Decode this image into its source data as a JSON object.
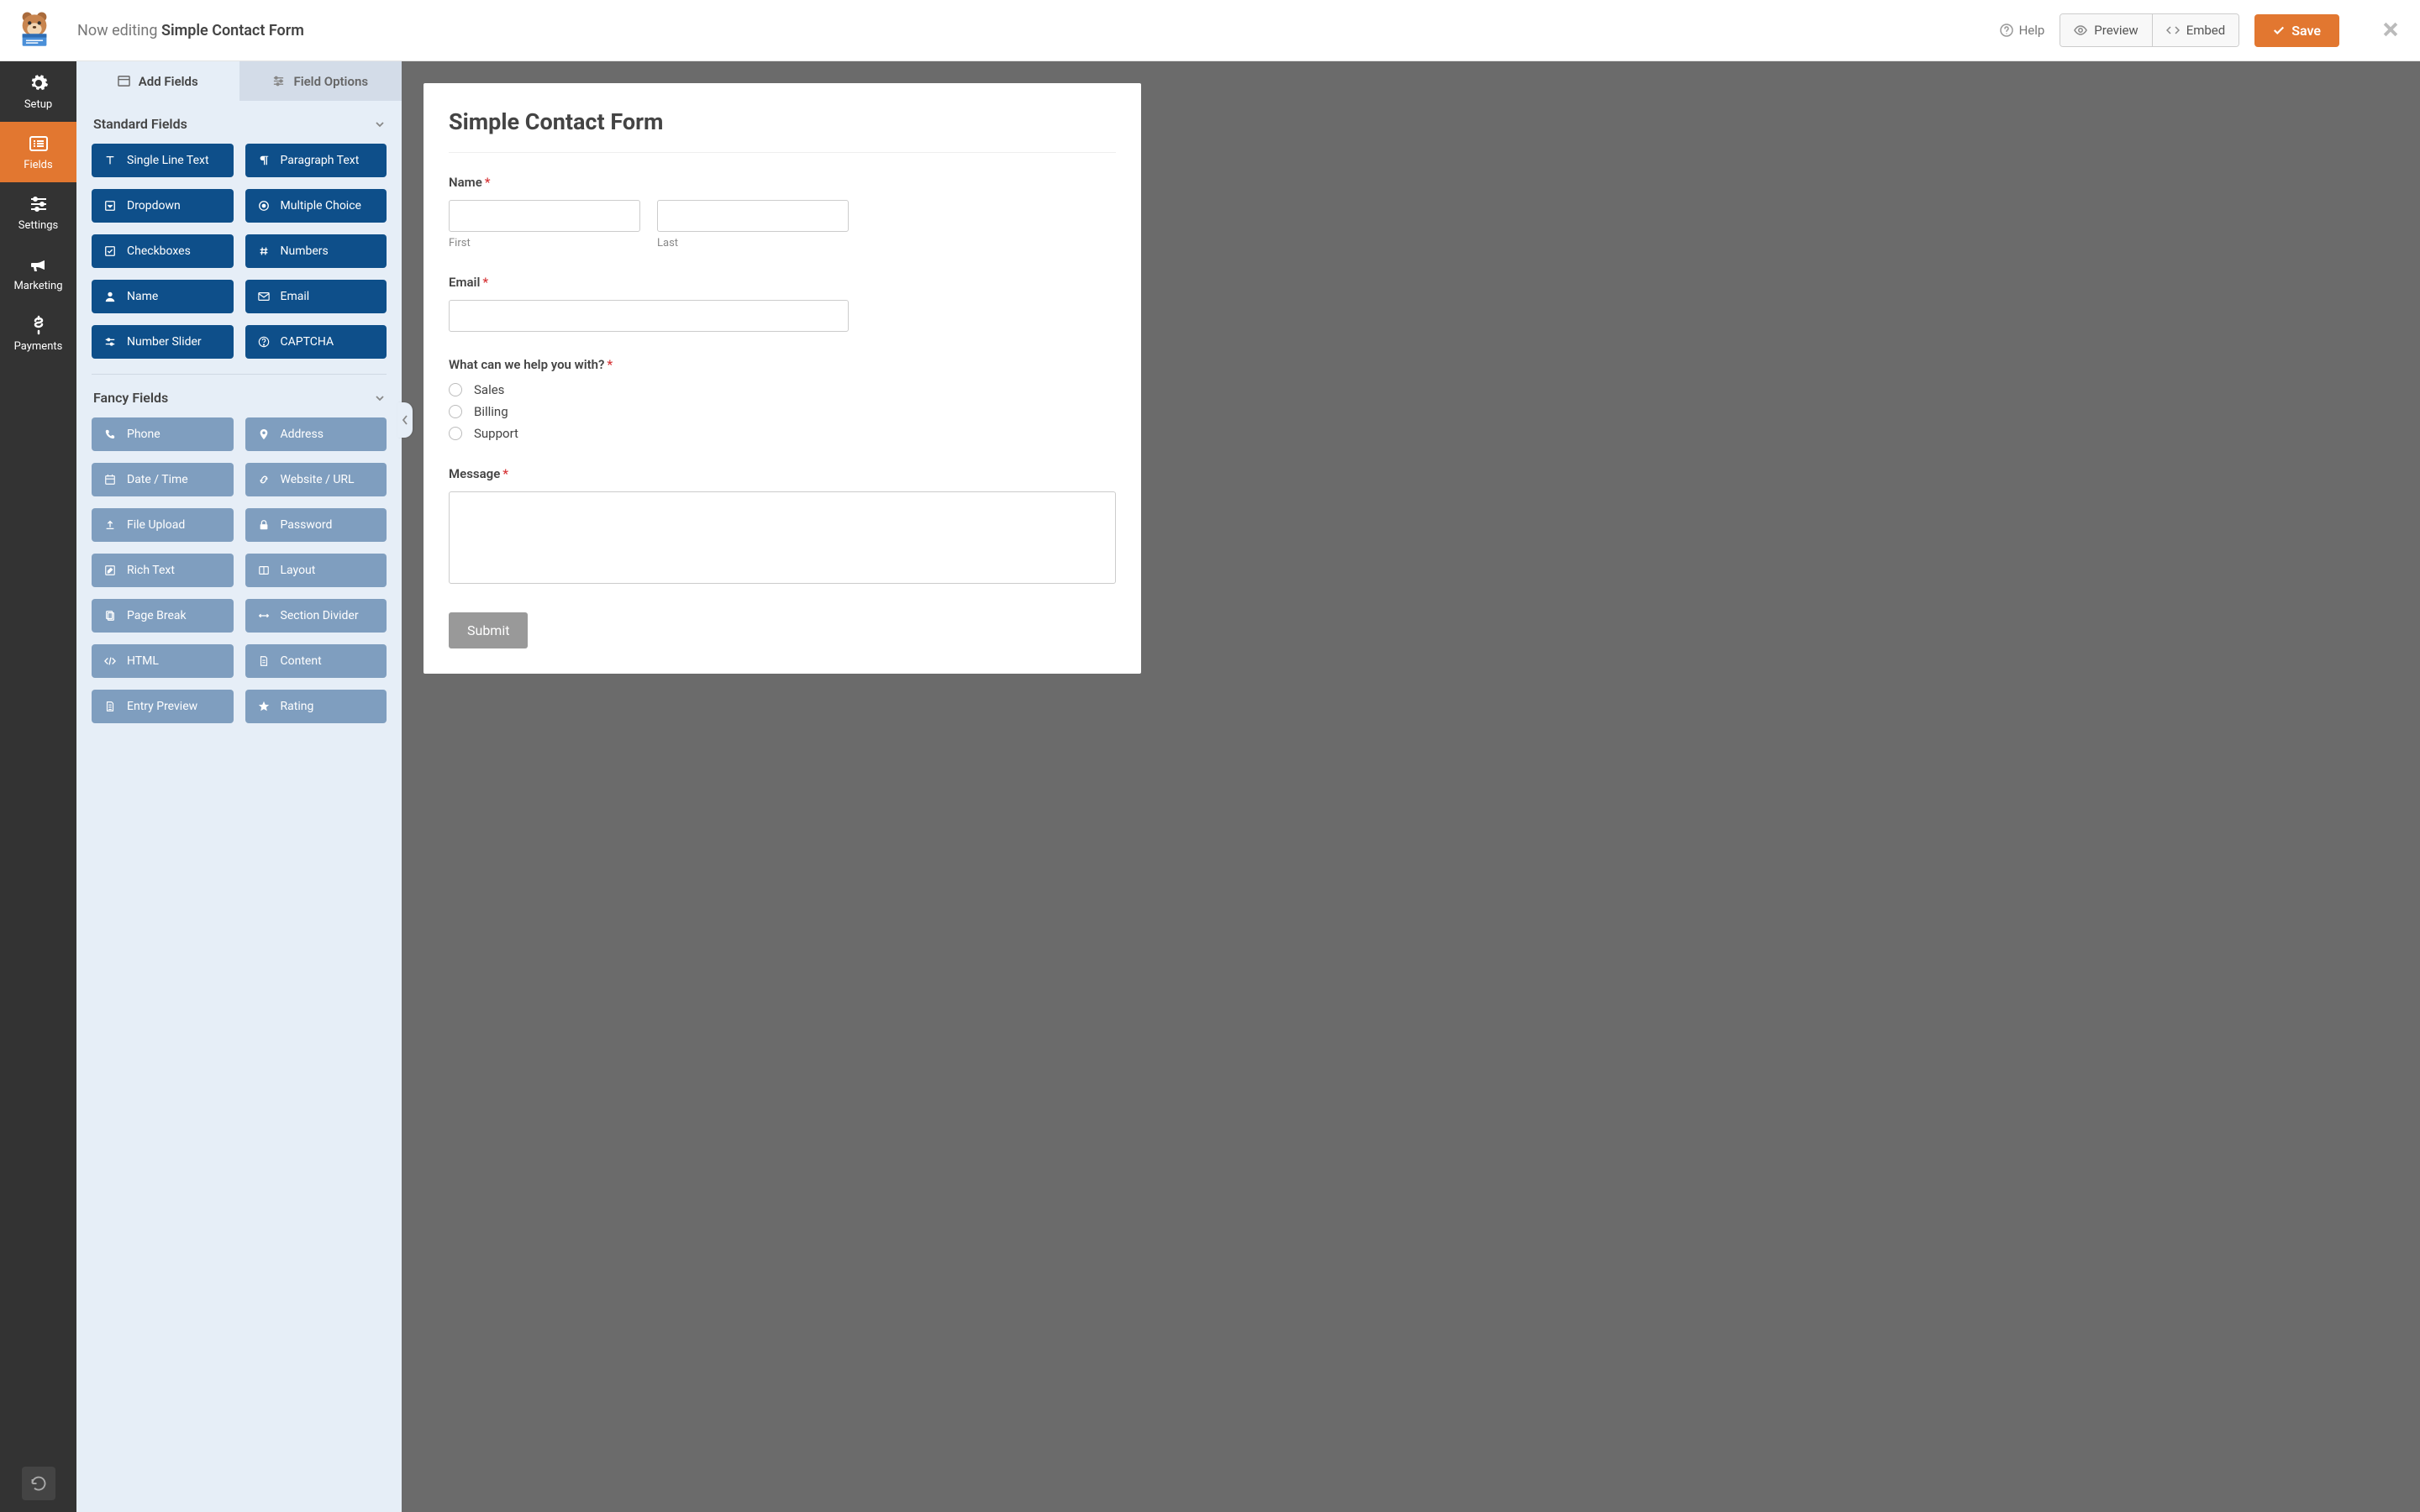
{
  "topbar": {
    "title_prefix": "Now editing",
    "title_name": "Simple Contact Form",
    "help": "Help",
    "preview": "Preview",
    "embed": "Embed",
    "save": "Save"
  },
  "vnav": {
    "items": [
      {
        "label": "Setup",
        "icon": "gear"
      },
      {
        "label": "Fields",
        "icon": "list",
        "active": true
      },
      {
        "label": "Settings",
        "icon": "sliders"
      },
      {
        "label": "Marketing",
        "icon": "bullhorn"
      },
      {
        "label": "Payments",
        "icon": "dollar"
      }
    ]
  },
  "panel": {
    "tabs": {
      "add": "Add Fields",
      "options": "Field Options"
    },
    "sections": [
      {
        "title": "Standard Fields",
        "style": "primary",
        "items": [
          {
            "label": "Single Line Text",
            "icon": "text"
          },
          {
            "label": "Paragraph Text",
            "icon": "paragraph"
          },
          {
            "label": "Dropdown",
            "icon": "caret-square"
          },
          {
            "label": "Multiple Choice",
            "icon": "dot-circle"
          },
          {
            "label": "Checkboxes",
            "icon": "check-square"
          },
          {
            "label": "Numbers",
            "icon": "hash"
          },
          {
            "label": "Name",
            "icon": "user"
          },
          {
            "label": "Email",
            "icon": "envelope"
          },
          {
            "label": "Number Slider",
            "icon": "sliders-h"
          },
          {
            "label": "CAPTCHA",
            "icon": "question-circle"
          }
        ]
      },
      {
        "title": "Fancy Fields",
        "style": "secondary",
        "items": [
          {
            "label": "Phone",
            "icon": "phone"
          },
          {
            "label": "Address",
            "icon": "map-marker"
          },
          {
            "label": "Date / Time",
            "icon": "calendar"
          },
          {
            "label": "Website / URL",
            "icon": "link"
          },
          {
            "label": "File Upload",
            "icon": "upload"
          },
          {
            "label": "Password",
            "icon": "lock"
          },
          {
            "label": "Rich Text",
            "icon": "pencil-square"
          },
          {
            "label": "Layout",
            "icon": "columns"
          },
          {
            "label": "Page Break",
            "icon": "files"
          },
          {
            "label": "Section Divider",
            "icon": "arrows-h"
          },
          {
            "label": "HTML",
            "icon": "code"
          },
          {
            "label": "Content",
            "icon": "file-text"
          },
          {
            "label": "Entry Preview",
            "icon": "file-lines"
          },
          {
            "label": "Rating",
            "icon": "star"
          }
        ]
      }
    ]
  },
  "form": {
    "title": "Simple Contact Form",
    "name_label": "Name",
    "first_sub": "First",
    "last_sub": "Last",
    "email_label": "Email",
    "help_label": "What can we help you with?",
    "help_options": [
      "Sales",
      "Billing",
      "Support"
    ],
    "message_label": "Message",
    "submit": "Submit"
  }
}
